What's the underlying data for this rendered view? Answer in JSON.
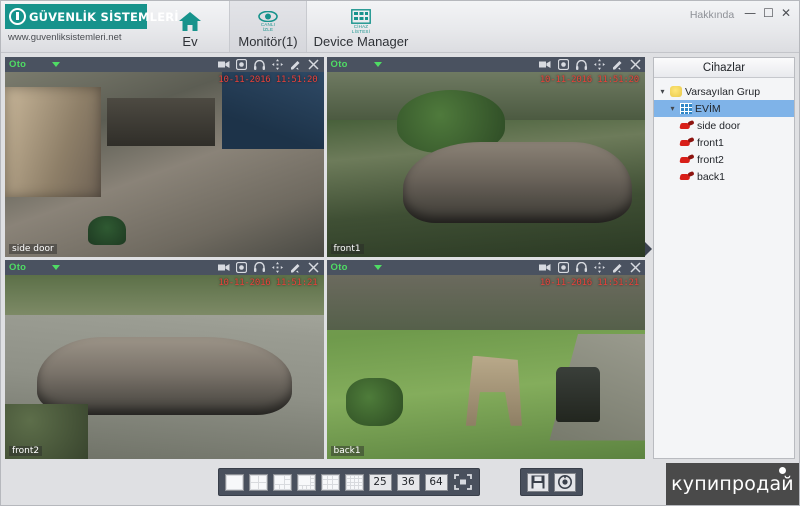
{
  "window": {
    "about_label": "Hakkında",
    "minimize_label": "—",
    "maximize_label": "☐",
    "close_label": "✕"
  },
  "brand": {
    "name": "GÜVENLİK SİSTEMLERİ",
    "url": "www.guvenliksistemleri.net",
    "logo_color": "#17938c"
  },
  "tabs": [
    {
      "label": "Ev",
      "icon": "home-icon",
      "active": false,
      "icon_caption1": "",
      "icon_caption2": ""
    },
    {
      "label": "Monitör(1)",
      "icon": "live-view-eye-icon",
      "active": true,
      "icon_caption1": "CANLI",
      "icon_caption2": "İZLE"
    },
    {
      "label": "Device Manager",
      "icon": "device-list-grid-icon",
      "active": false,
      "icon_caption1": "CİHAZ",
      "icon_caption2": "LİSTESİ"
    }
  ],
  "panel_toolbar": {
    "stream_mode_label": "Oto",
    "icons": [
      "video-record-icon",
      "snapshot-icon",
      "audio-icon",
      "ptz-move-icon",
      "edit-icon",
      "close-icon"
    ]
  },
  "cells": [
    {
      "camera": "side door",
      "timestamp": "10-11-2016 11:51:20",
      "mode": "Oto",
      "scene": "sc1"
    },
    {
      "camera": "front1",
      "timestamp": "10-11-2016 11:51:20",
      "mode": "Oto",
      "scene": "sc2"
    },
    {
      "camera": "front2",
      "timestamp": "10-11-2016 11:51:21",
      "mode": "Oto",
      "scene": "sc3"
    },
    {
      "camera": "back1",
      "timestamp": "10-11-2016 11:51:21",
      "mode": "Oto",
      "scene": "sc4"
    }
  ],
  "sidebar": {
    "title": "Cihazlar",
    "tree": [
      {
        "label": "Varsayılan Grup",
        "icon": "folder-icon",
        "level": 0,
        "expanded": true,
        "selected": false
      },
      {
        "label": "EVİM",
        "icon": "device-icon",
        "level": 1,
        "expanded": true,
        "selected": true
      },
      {
        "label": "side door",
        "icon": "camera-icon",
        "level": 2,
        "expanded": null,
        "selected": false
      },
      {
        "label": "front1",
        "icon": "camera-icon",
        "level": 2,
        "expanded": null,
        "selected": false
      },
      {
        "label": "front2",
        "icon": "camera-icon",
        "level": 2,
        "expanded": null,
        "selected": false
      },
      {
        "label": "back1",
        "icon": "camera-icon",
        "level": 2,
        "expanded": null,
        "selected": false
      }
    ],
    "selected_highlight_color": "#7fb3e8"
  },
  "bottom_bar": {
    "layouts": [
      {
        "name": "layout-1",
        "cells": 1,
        "label": ""
      },
      {
        "name": "layout-4",
        "cells": 4,
        "label": ""
      },
      {
        "name": "layout-6",
        "cells": 6,
        "label": ""
      },
      {
        "name": "layout-8",
        "cells": 8,
        "label": ""
      },
      {
        "name": "layout-9",
        "cells": 9,
        "label": ""
      },
      {
        "name": "layout-16",
        "cells": 16,
        "label": ""
      }
    ],
    "numeric_layouts": [
      "25",
      "36",
      "64"
    ],
    "fullscreen_icon": "fullscreen-icon",
    "action_buttons": [
      "save-icon",
      "playback-icon"
    ]
  },
  "watermark": {
    "text": "купипродай"
  }
}
